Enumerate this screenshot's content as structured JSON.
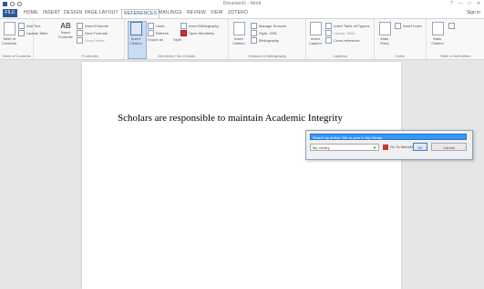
{
  "window": {
    "title": "Document1 - Word",
    "controls": [
      "?",
      "—",
      "□",
      "✕"
    ]
  },
  "quick_access": [
    "save",
    "undo",
    "redo"
  ],
  "tabs": [
    "FILE",
    "HOME",
    "INSERT",
    "DESIGN",
    "PAGE LAYOUT",
    "REFERENCES",
    "MAILINGS",
    "REVIEW",
    "VIEW",
    "ZOTERO"
  ],
  "active_tab": "REFERENCES",
  "account": "Sign in",
  "ribbon": {
    "toc": {
      "label": "Table of Contents",
      "add_text": "Add Text",
      "update": "Update Table",
      "group": "Table of Contents"
    },
    "footnotes": {
      "insert_footnote": "Insert Footnote",
      "insert_endnote": "Insert Endnote",
      "next_footnote": "Next Footnote",
      "show_notes": "Show Notes",
      "ab": "AB",
      "group": "Footnotes"
    },
    "citations": {
      "insert_citation": "Insert Citation",
      "style_label": "Style:",
      "style_value": "APA",
      "manage": "Manage Sources",
      "bibliography": "Bibliography",
      "group": "Citations & Bibliography"
    },
    "captions": {
      "insert_caption": "Insert Caption",
      "table_of_figures": "Insert Table of Figures",
      "update_table": "Update Table",
      "cross_ref": "Cross-reference",
      "group": "Captions"
    },
    "index": {
      "mark_entry": "Mark Entry",
      "insert_index": "Insert Index",
      "group": "Index"
    },
    "authorities": {
      "mark_citation": "Mark Citation",
      "insert_table": "Insert Table of Authorities",
      "group": "Table of Authorities"
    },
    "mendeley": {
      "undo": "Undo",
      "refresh": "Refresh",
      "export": "Export as",
      "style": "Style:",
      "insert_bibliography": "Insert Bibliography",
      "open_mendeley": "Open Mendeley",
      "group": "Mendeley Cite-O-Matic"
    }
  },
  "document": {
    "text": "Scholars are responsible to maintain Academic Integrity"
  },
  "cite_dialog": {
    "input_value": "Search by author, title or year in My Library",
    "library": "My Library",
    "go_to_mendeley": "Go To Mendeley",
    "ok": "OK",
    "cancel": "Cancel"
  }
}
